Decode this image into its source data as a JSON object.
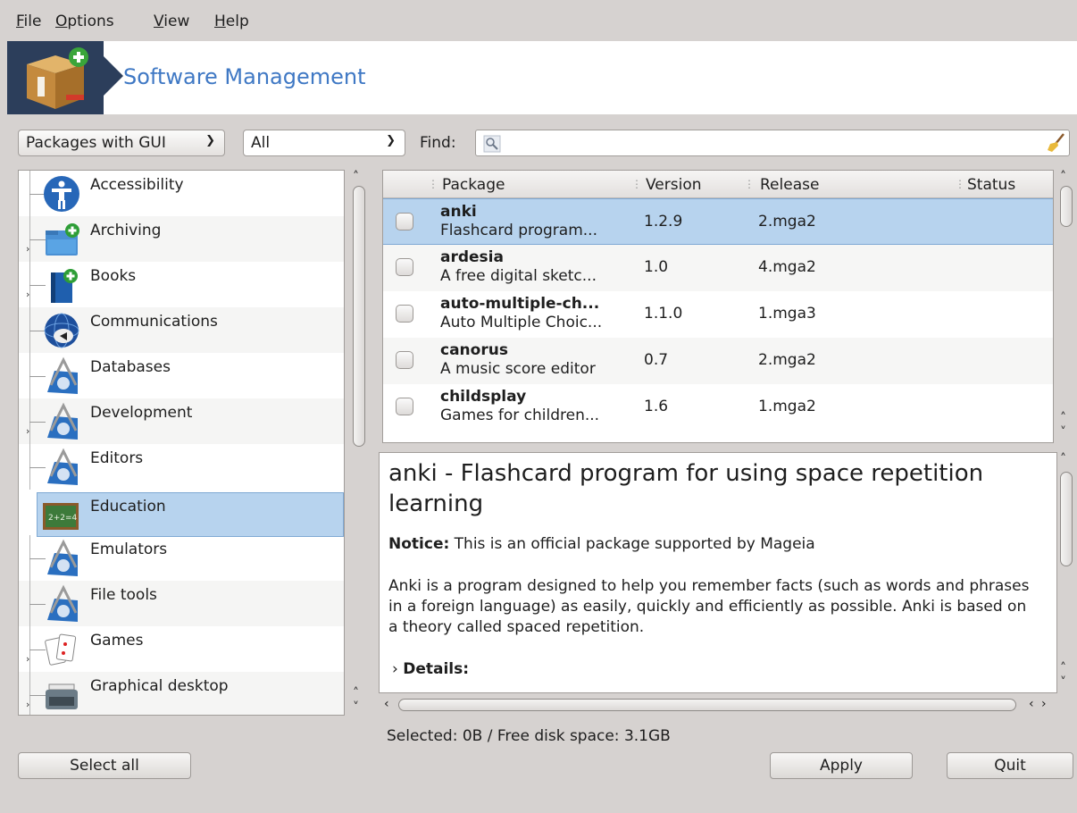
{
  "menu": [
    {
      "mnemonic": "F",
      "rest": "ile"
    },
    {
      "mnemonic": "O",
      "rest": "ptions"
    },
    {
      "mnemonic": "V",
      "rest": "iew"
    },
    {
      "mnemonic": "H",
      "rest": "elp"
    }
  ],
  "banner": {
    "title": "Software Management",
    "icon": "package-box-icon"
  },
  "filters": {
    "type_value": "Packages with GUI",
    "state_value": "All",
    "find_label": "Find:",
    "find_value": "",
    "search_icon": "magnifier-icon",
    "clear_icon": "broom-icon"
  },
  "categories": [
    {
      "label": "Accessibility",
      "icon": "accessibility-icon",
      "expandable": false
    },
    {
      "label": "Archiving",
      "icon": "archive-folder-icon",
      "expandable": true
    },
    {
      "label": "Books",
      "icon": "book-icon",
      "expandable": true
    },
    {
      "label": "Communications",
      "icon": "globe-icon",
      "expandable": false
    },
    {
      "label": "Databases",
      "icon": "development-icon",
      "expandable": false
    },
    {
      "label": "Development",
      "icon": "development-icon",
      "expandable": true
    },
    {
      "label": "Editors",
      "icon": "development-icon",
      "expandable": false
    },
    {
      "label": "Education",
      "icon": "chalkboard-icon",
      "expandable": false,
      "selected": true
    },
    {
      "label": "Emulators",
      "icon": "development-icon",
      "expandable": false
    },
    {
      "label": "File tools",
      "icon": "development-icon",
      "expandable": false
    },
    {
      "label": "Games",
      "icon": "playing-cards-icon",
      "expandable": true
    },
    {
      "label": "Graphical desktop",
      "icon": "typewriter-icon",
      "expandable": true
    }
  ],
  "packages": {
    "columns": [
      "Package",
      "Version",
      "Release",
      "Status"
    ],
    "rows": [
      {
        "name": "anki",
        "summary": "Flashcard program...",
        "version": "1.2.9",
        "release": "2.mga2",
        "selected": true
      },
      {
        "name": "ardesia",
        "summary": "A free digital sketc...",
        "version": "1.0",
        "release": "4.mga2"
      },
      {
        "name": "auto-multiple-ch...",
        "summary": "Auto Multiple Choic...",
        "version": "1.1.0",
        "release": "1.mga3"
      },
      {
        "name": "canorus",
        "summary": "A music score editor",
        "version": "0.7",
        "release": "2.mga2"
      },
      {
        "name": "childsplay",
        "summary": "Games for children...",
        "version": "1.6",
        "release": "1.mga2"
      }
    ]
  },
  "description": {
    "title": "anki - Flashcard program for using space repetition learning",
    "notice_label": "Notice:",
    "notice_text": " This is an official package supported by Mageia",
    "body": "Anki is a program designed to help you remember facts (such as words and phrases in a foreign language) as easily, quickly and efficiently as possible. Anki is based on a theory called spaced repetition.",
    "details_label": "Details:"
  },
  "status": "Selected: 0B / Free disk space: 3.1GB",
  "buttons": {
    "select_all": "Select all",
    "apply": "Apply",
    "quit": "Quit"
  }
}
